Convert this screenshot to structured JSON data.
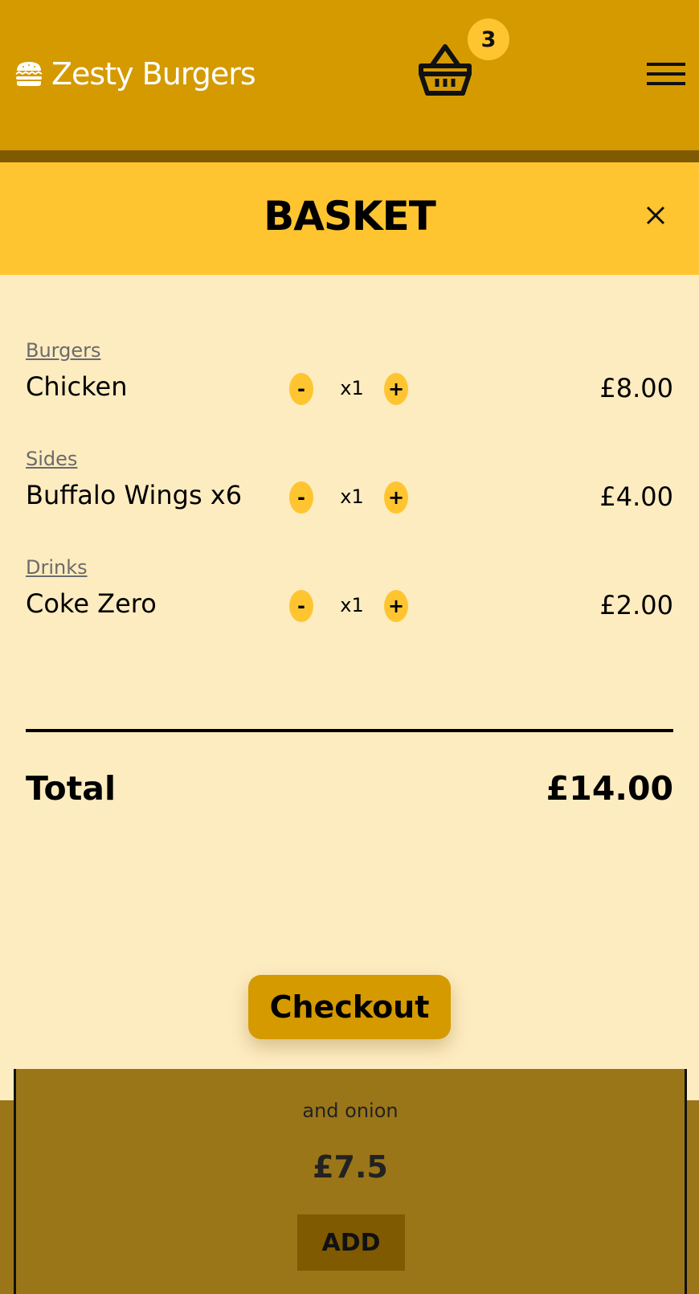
{
  "header": {
    "brand_name": "Zesty Burgers",
    "brand_icon": "burger-icon",
    "basket_icon": "basket-icon",
    "cart_count": "3",
    "menu_icon": "hamburger-menu-icon"
  },
  "basket": {
    "title": "BASKET",
    "close_icon": "close-icon",
    "items": [
      {
        "category": "Burgers",
        "name": "Chicken",
        "minus": "-",
        "quantity": "x1",
        "plus": "+",
        "price": "£8.00"
      },
      {
        "category": "Sides",
        "name": "Buffalo Wings x6",
        "minus": "-",
        "quantity": "x1",
        "plus": "+",
        "price": "£4.00"
      },
      {
        "category": "Drinks",
        "name": "Coke Zero",
        "minus": "-",
        "quantity": "x1",
        "plus": "+",
        "price": "£2.00"
      }
    ],
    "total_label": "Total",
    "total_value": "£14.00",
    "checkout_label": "Checkout"
  },
  "background_card": {
    "description_fragment": "and onion",
    "price": "£7.5",
    "add_label": "ADD"
  },
  "colors": {
    "header_bg": "#d49a00",
    "accent": "#ffc531",
    "panel_bg": "#fdecc0",
    "overlay": "#9a7618"
  }
}
